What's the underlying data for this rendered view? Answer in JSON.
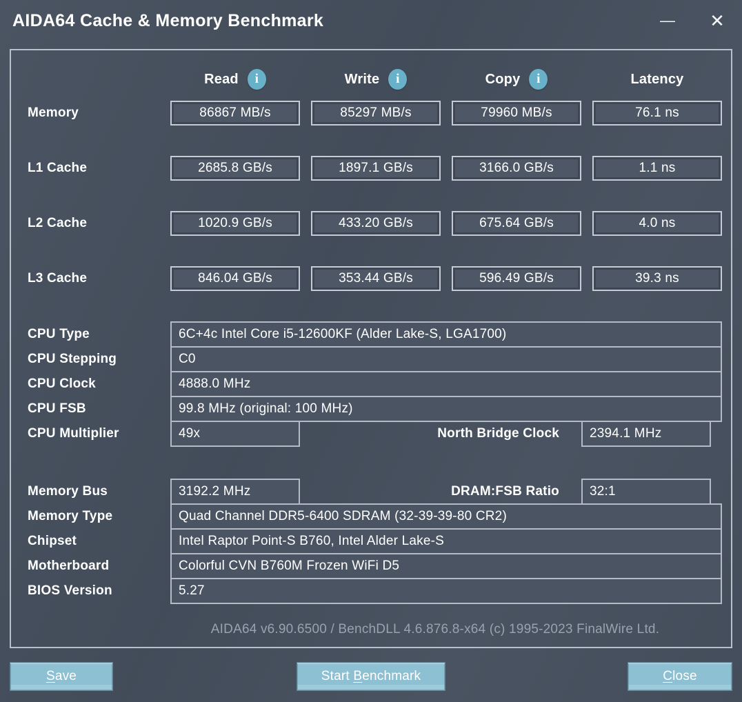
{
  "window": {
    "title": "AIDA64 Cache & Memory Benchmark",
    "minimize_glyph": "—",
    "close_glyph": "✕"
  },
  "header": {
    "columns": [
      "Read",
      "Write",
      "Copy",
      "Latency"
    ],
    "info_glyph": "i"
  },
  "benchmark_rows": [
    {
      "label": "Memory",
      "values": [
        "86867 MB/s",
        "85297 MB/s",
        "79960 MB/s",
        "76.1 ns"
      ]
    },
    {
      "label": "L1 Cache",
      "values": [
        "2685.8 GB/s",
        "1897.1 GB/s",
        "3166.0 GB/s",
        "1.1 ns"
      ]
    },
    {
      "label": "L2 Cache",
      "values": [
        "1020.9 GB/s",
        "433.20 GB/s",
        "675.64 GB/s",
        "4.0 ns"
      ]
    },
    {
      "label": "L3 Cache",
      "values": [
        "846.04 GB/s",
        "353.44 GB/s",
        "596.49 GB/s",
        "39.3 ns"
      ]
    }
  ],
  "cpu_info": {
    "cpu_type": {
      "label": "CPU Type",
      "value": "6C+4c Intel Core i5-12600KF  (Alder Lake-S, LGA1700)"
    },
    "cpu_stepping": {
      "label": "CPU Stepping",
      "value": "C0"
    },
    "cpu_clock": {
      "label": "CPU Clock",
      "value": "4888.0 MHz"
    },
    "cpu_fsb": {
      "label": "CPU FSB",
      "value": "99.8 MHz  (original: 100 MHz)"
    },
    "cpu_multiplier": {
      "label": "CPU Multiplier",
      "value": "49x"
    },
    "north_bridge_clock": {
      "label": "North Bridge Clock",
      "value": "2394.1 MHz"
    }
  },
  "memory_info": {
    "memory_bus": {
      "label": "Memory Bus",
      "value": "3192.2 MHz"
    },
    "dram_fsb_ratio": {
      "label": "DRAM:FSB Ratio",
      "value": "32:1"
    },
    "memory_type": {
      "label": "Memory Type",
      "value": "Quad Channel DDR5-6400 SDRAM  (32-39-39-80 CR2)"
    },
    "chipset": {
      "label": "Chipset",
      "value": "Intel Raptor Point-S B760, Intel Alder Lake-S"
    },
    "motherboard": {
      "label": "Motherboard",
      "value": "Colorful CVN B760M Frozen WiFi D5"
    },
    "bios_version": {
      "label": "BIOS Version",
      "value": "5.27"
    }
  },
  "footer": {
    "text": "AIDA64 v6.90.6500 / BenchDLL 4.6.876.8-x64  (c) 1995-2023 FinalWire Ltd."
  },
  "buttons": {
    "save": {
      "pre": "",
      "mnemonic": "S",
      "post": "ave"
    },
    "start_benchmark": {
      "pre": "Start ",
      "mnemonic": "B",
      "post": "enchmark"
    },
    "close": {
      "pre": "",
      "mnemonic": "C",
      "post": "lose"
    }
  },
  "colors": {
    "window_background": "#46505e",
    "panel_border": "#b9c0ca",
    "box_border": "#c6ccd6",
    "info_icon_background": "#68b1c8",
    "button_background": "#8dc0d3",
    "footer_text": "#9aa2ad",
    "text": "#ffffff"
  }
}
